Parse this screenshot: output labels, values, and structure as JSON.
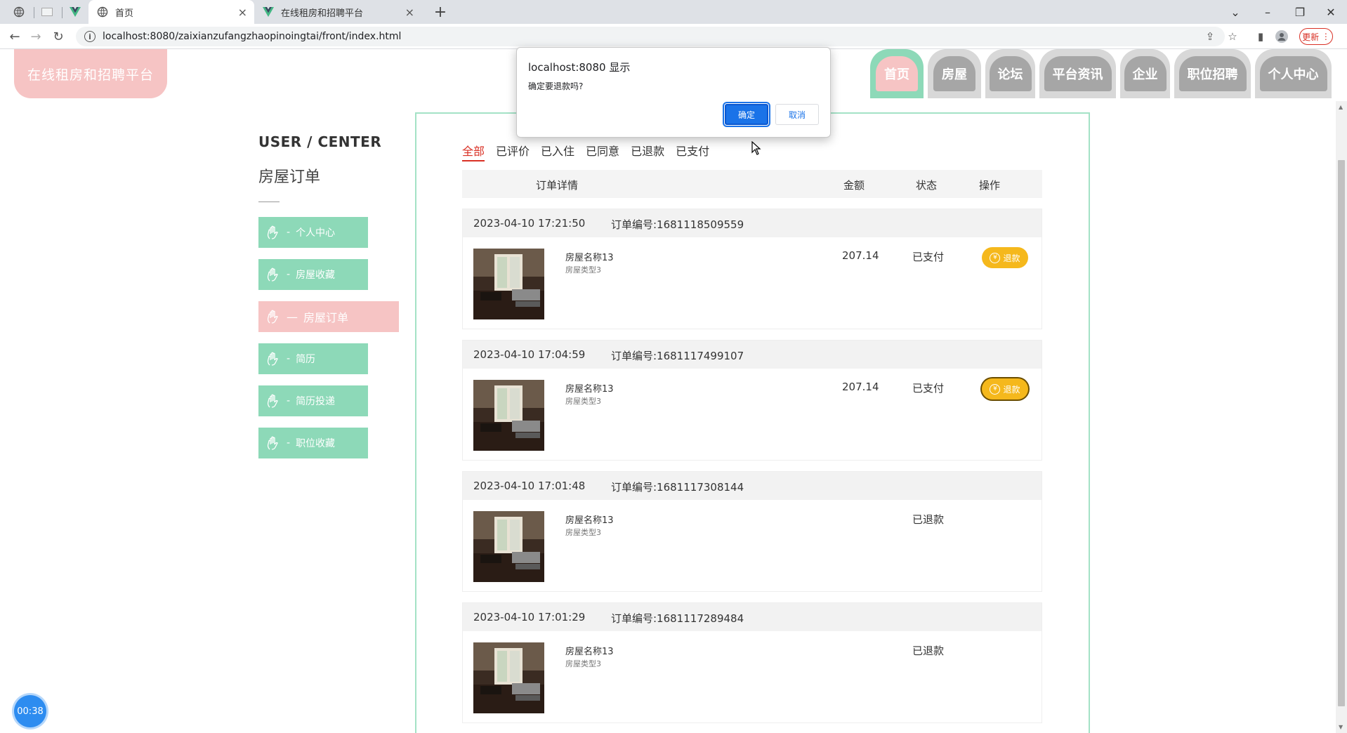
{
  "browser": {
    "tabs": [
      {
        "title": "首页"
      },
      {
        "title": "在线租房和招聘平台"
      }
    ],
    "url": "localhost:8080/zaixianzufangzhaopinoingtai/front/index.html",
    "update_label": "更新"
  },
  "site": {
    "logo": "在线租房和招聘平台",
    "nav": [
      {
        "label": "首页",
        "active": true
      },
      {
        "label": "房屋"
      },
      {
        "label": "论坛"
      },
      {
        "label": "平台资讯"
      },
      {
        "label": "企业"
      },
      {
        "label": "职位招聘"
      },
      {
        "label": "个人中心"
      }
    ]
  },
  "sidebar": {
    "title": "USER / CENTER",
    "subtitle": "房屋订单",
    "items": [
      {
        "label": "个人中心"
      },
      {
        "label": "房屋收藏"
      },
      {
        "label": "房屋订单",
        "active": true
      },
      {
        "label": "简历"
      },
      {
        "label": "简历投递"
      },
      {
        "label": "职位收藏"
      }
    ]
  },
  "orders": {
    "filters": [
      "全部",
      "已评价",
      "已入住",
      "已同意",
      "已退款",
      "已支付"
    ],
    "selected_filter": "全部",
    "columns": {
      "detail": "订单详情",
      "amount": "金额",
      "status": "状态",
      "action": "操作"
    },
    "items": [
      {
        "time": "2023-04-10 17:21:50",
        "order_no": "订单编号:1681118509559",
        "name": "房屋名称13",
        "type": "房屋类型3",
        "amount": "207.14",
        "status": "已支付",
        "action": "退款"
      },
      {
        "time": "2023-04-10 17:04:59",
        "order_no": "订单编号:1681117499107",
        "name": "房屋名称13",
        "type": "房屋类型3",
        "amount": "207.14",
        "status": "已支付",
        "action": "退款"
      },
      {
        "time": "2023-04-10 17:01:48",
        "order_no": "订单编号:1681117308144",
        "name": "房屋名称13",
        "type": "房屋类型3",
        "amount": "",
        "status": "已退款",
        "action": ""
      },
      {
        "time": "2023-04-10 17:01:29",
        "order_no": "订单编号:1681117289484",
        "name": "房屋名称13",
        "type": "房屋类型3",
        "amount": "",
        "status": "已退款",
        "action": ""
      }
    ]
  },
  "dialog": {
    "title": "localhost:8080 显示",
    "message": "确定要退款吗?",
    "ok": "确定",
    "cancel": "取消"
  },
  "timer": "00:38",
  "colors": {
    "accent_green": "#8dd9b8",
    "accent_pink": "#f6c4c4",
    "refund_yellow": "#f5b81c",
    "dialog_blue": "#1a73e8"
  }
}
